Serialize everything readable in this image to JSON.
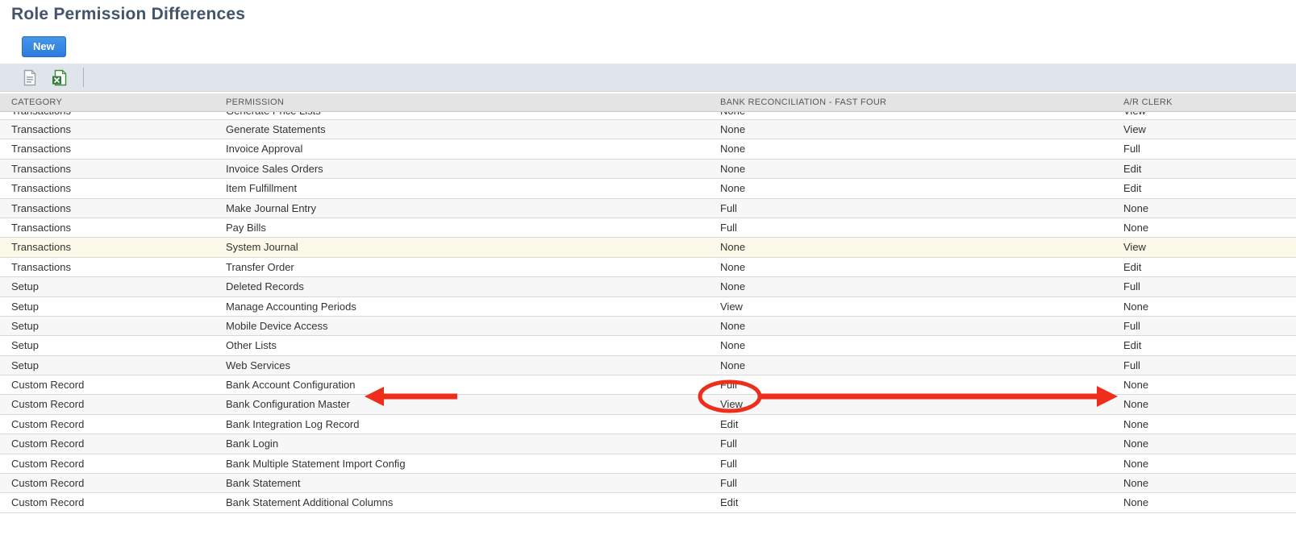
{
  "page": {
    "title": "Role Permission Differences"
  },
  "actions": {
    "new_button_label": "New"
  },
  "toolbar": {
    "icons": [
      {
        "name": "export-document-icon"
      },
      {
        "name": "export-excel-icon"
      }
    ]
  },
  "table": {
    "columns": {
      "category": "CATEGORY",
      "permission": "PERMISSION",
      "role1": "BANK RECONCILIATION - FAST FOUR",
      "role2": "A/R CLERK"
    },
    "rows": [
      {
        "category": "Transactions",
        "permission": "Generate Price Lists",
        "role1": "None",
        "role2": "View",
        "clipped": true
      },
      {
        "category": "Transactions",
        "permission": "Generate Statements",
        "role1": "None",
        "role2": "View"
      },
      {
        "category": "Transactions",
        "permission": "Invoice Approval",
        "role1": "None",
        "role2": "Full"
      },
      {
        "category": "Transactions",
        "permission": "Invoice Sales Orders",
        "role1": "None",
        "role2": "Edit"
      },
      {
        "category": "Transactions",
        "permission": "Item Fulfillment",
        "role1": "None",
        "role2": "Edit"
      },
      {
        "category": "Transactions",
        "permission": "Make Journal Entry",
        "role1": "Full",
        "role2": "None"
      },
      {
        "category": "Transactions",
        "permission": "Pay Bills",
        "role1": "Full",
        "role2": "None"
      },
      {
        "category": "Transactions",
        "permission": "System Journal",
        "role1": "None",
        "role2": "View",
        "highlight": "yellow"
      },
      {
        "category": "Transactions",
        "permission": "Transfer Order",
        "role1": "None",
        "role2": "Edit"
      },
      {
        "category": "Setup",
        "permission": "Deleted Records",
        "role1": "None",
        "role2": "Full"
      },
      {
        "category": "Setup",
        "permission": "Manage Accounting Periods",
        "role1": "View",
        "role2": "None"
      },
      {
        "category": "Setup",
        "permission": "Mobile Device Access",
        "role1": "None",
        "role2": "Full"
      },
      {
        "category": "Setup",
        "permission": "Other Lists",
        "role1": "None",
        "role2": "Edit"
      },
      {
        "category": "Setup",
        "permission": "Web Services",
        "role1": "None",
        "role2": "Full"
      },
      {
        "category": "Custom Record",
        "permission": "Bank Account Configuration",
        "role1": "Full",
        "role2": "None",
        "annotated": true
      },
      {
        "category": "Custom Record",
        "permission": "Bank Configuration Master",
        "role1": "View",
        "role2": "None"
      },
      {
        "category": "Custom Record",
        "permission": "Bank Integration Log Record",
        "role1": "Edit",
        "role2": "None"
      },
      {
        "category": "Custom Record",
        "permission": "Bank Login",
        "role1": "Full",
        "role2": "None"
      },
      {
        "category": "Custom Record",
        "permission": "Bank Multiple Statement Import Config",
        "role1": "Full",
        "role2": "None"
      },
      {
        "category": "Custom Record",
        "permission": "Bank Statement",
        "role1": "Full",
        "role2": "None"
      },
      {
        "category": "Custom Record",
        "permission": "Bank Statement Additional Columns",
        "role1": "Edit",
        "role2": "None"
      }
    ]
  },
  "annotations": {
    "color": "#ee2d1c",
    "items": [
      "left-arrow-pointing-at-bank-account-configuration",
      "circle-around-full-value",
      "right-arrow-pointing-at-none-value"
    ]
  }
}
